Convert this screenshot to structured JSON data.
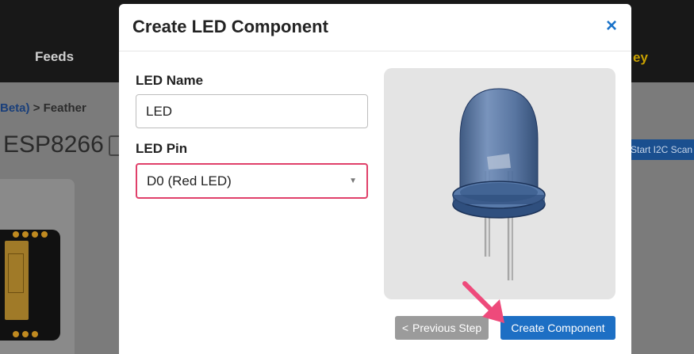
{
  "background": {
    "nav_feeds": "Feeds",
    "nav_key": "ey",
    "breadcrumb_link": "Beta)",
    "breadcrumb_sep": ">",
    "breadcrumb_current": "Feather",
    "page_title": "ESP8266",
    "i2c_button": "Start I2C Scan"
  },
  "modal": {
    "title": "Create LED Component",
    "close_label": "×",
    "led_name_label": "LED Name",
    "led_name_value": "LED",
    "led_pin_label": "LED Pin",
    "led_pin_selected": "D0 (Red LED)",
    "prev_button": "Previous Step",
    "prev_button_icon": "<",
    "create_button": "Create Component"
  },
  "icons": {
    "close": "close-icon",
    "caret": "chevron-down-icon",
    "back": "chevron-left-icon",
    "pointer": "arrow-pointer-icon"
  },
  "colors": {
    "accent": "#1d6fc4",
    "highlight_border": "#e0406a",
    "arrow": "#ee4a7b"
  }
}
